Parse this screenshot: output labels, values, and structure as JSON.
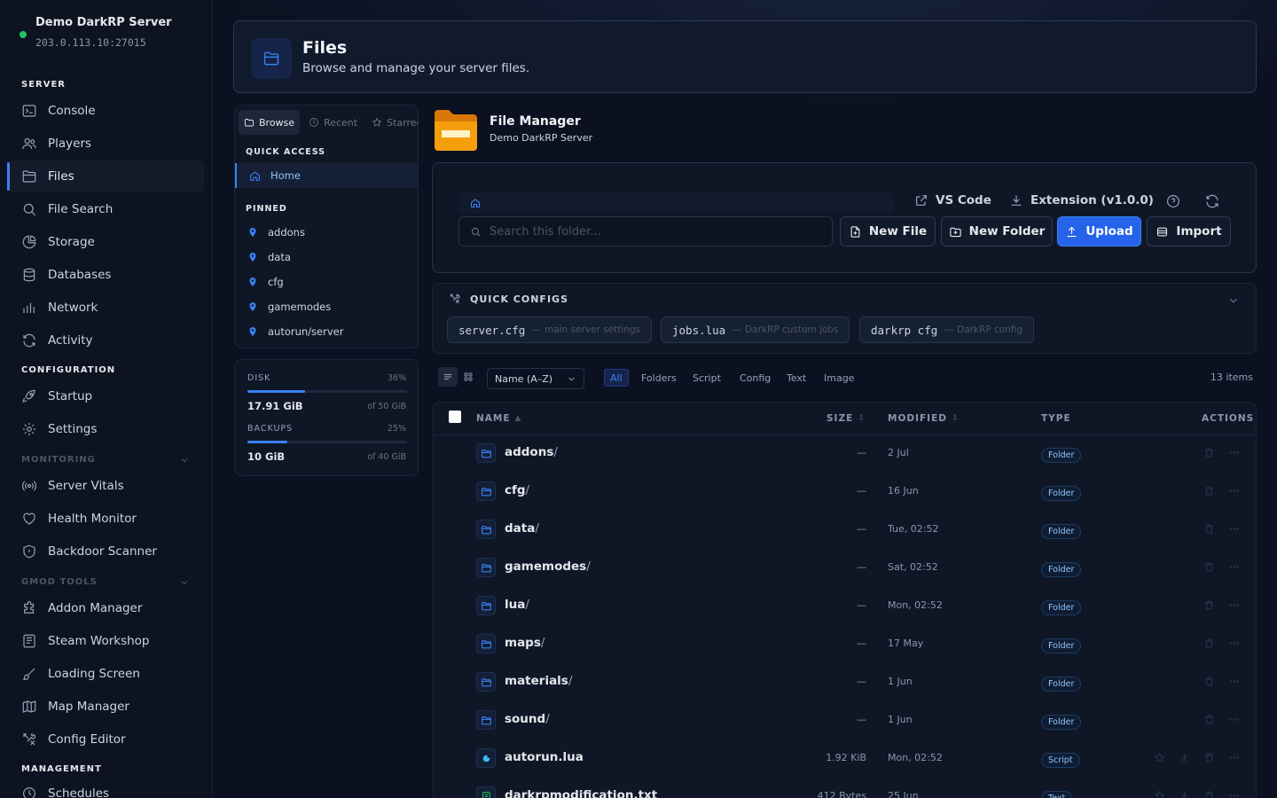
{
  "server": {
    "name": "Demo DarkRP Server",
    "address": "203.0.113.10:27015",
    "status_color": "#22c55e"
  },
  "sidebar": {
    "sections": {
      "server": "SERVER",
      "configuration": "CONFIGURATION",
      "monitoring": "MONITORING",
      "gmod_tools": "GMOD TOOLS",
      "management": "MANAGEMENT"
    },
    "items": {
      "console": "Console",
      "players": "Players",
      "files": "Files",
      "file_search": "File Search",
      "storage": "Storage",
      "databases": "Databases",
      "network": "Network",
      "activity": "Activity",
      "startup": "Startup",
      "settings": "Settings",
      "server_vitals": "Server Vitals",
      "health_monitor": "Health Monitor",
      "backdoor_scanner": "Backdoor Scanner",
      "addon_manager": "Addon Manager",
      "steam_workshop": "Steam Workshop",
      "loading_screen": "Loading Screen",
      "map_manager": "Map Manager",
      "config_editor": "Config Editor",
      "schedules": "Schedules"
    },
    "active": "files"
  },
  "header": {
    "title": "Files",
    "subtitle": "Browse and manage your server files."
  },
  "browser": {
    "tabs": {
      "browse": "Browse",
      "recent": "Recent",
      "starred": "Starred"
    },
    "quick_access_title": "QUICK ACCESS",
    "home": "Home",
    "pinned_title": "PINNED",
    "pinned": [
      "addons",
      "data",
      "cfg",
      "gamemodes",
      "autorun/server"
    ]
  },
  "usage": {
    "disk": {
      "label": "DISK",
      "percent": "36%",
      "fraction": 0.36,
      "used": "17.91 GiB",
      "total": "of 50 GiB"
    },
    "backups": {
      "label": "BACKUPS",
      "percent": "25%",
      "fraction": 0.25,
      "used": "10 GiB",
      "total": "of 40 GiB"
    }
  },
  "file_manager": {
    "title": "File Manager",
    "subtitle": "Demo DarkRP Server",
    "vscode": "VS Code",
    "extension": "Extension (v1.0.0)",
    "search_placeholder": "Search this folder...",
    "buttons": {
      "new_file": "New File",
      "new_folder": "New Folder",
      "upload": "Upload",
      "import": "Import"
    }
  },
  "quick_configs": {
    "title": "QUICK CONFIGS",
    "chips": [
      {
        "code": "server.cfg",
        "desc": "— main server settings"
      },
      {
        "code": "jobs.lua",
        "desc": "— DarkRP custom jobs"
      },
      {
        "code": "darkrp cfg",
        "desc": "— DarkRP config"
      }
    ]
  },
  "filters": {
    "sort": "Name (A–Z)",
    "types": {
      "all": "All",
      "folders": "Folders",
      "script": "Script",
      "config": "Config",
      "text": "Text",
      "image": "Image"
    },
    "count": "13 items"
  },
  "table": {
    "columns": {
      "name": "NAME",
      "size": "SIZE",
      "modified": "MODIFIED",
      "type": "TYPE",
      "actions": "ACTIONS"
    },
    "rows": [
      {
        "name": "addons",
        "slash": "/",
        "size": "—",
        "modified": "2 Jul",
        "type": "Folder"
      },
      {
        "name": "cfg",
        "slash": "/",
        "size": "—",
        "modified": "16 Jun",
        "type": "Folder"
      },
      {
        "name": "data",
        "slash": "/",
        "size": "—",
        "modified": "Tue, 02:52",
        "type": "Folder"
      },
      {
        "name": "gamemodes",
        "slash": "/",
        "size": "—",
        "modified": "Sat, 02:52",
        "type": "Folder"
      },
      {
        "name": "lua",
        "slash": "/",
        "size": "—",
        "modified": "Mon, 02:52",
        "type": "Folder"
      },
      {
        "name": "maps",
        "slash": "/",
        "size": "—",
        "modified": "17 May",
        "type": "Folder"
      },
      {
        "name": "materials",
        "slash": "/",
        "size": "—",
        "modified": "1 Jun",
        "type": "Folder"
      },
      {
        "name": "sound",
        "slash": "/",
        "size": "—",
        "modified": "1 Jun",
        "type": "Folder"
      },
      {
        "name": "autorun.lua",
        "slash": "",
        "size": "1.92 KiB",
        "modified": "Mon, 02:52",
        "type": "Script"
      },
      {
        "name": "darkrpmodification.txt",
        "slash": "",
        "size": "412 Bytes",
        "modified": "25 Jun",
        "type": "Text"
      }
    ]
  },
  "colors": {
    "accent": "#3b82f6",
    "primary_button": "#2563eb",
    "background": "#0b1120",
    "panel": "#0f1727",
    "folder_icon": "#f59e0b"
  }
}
